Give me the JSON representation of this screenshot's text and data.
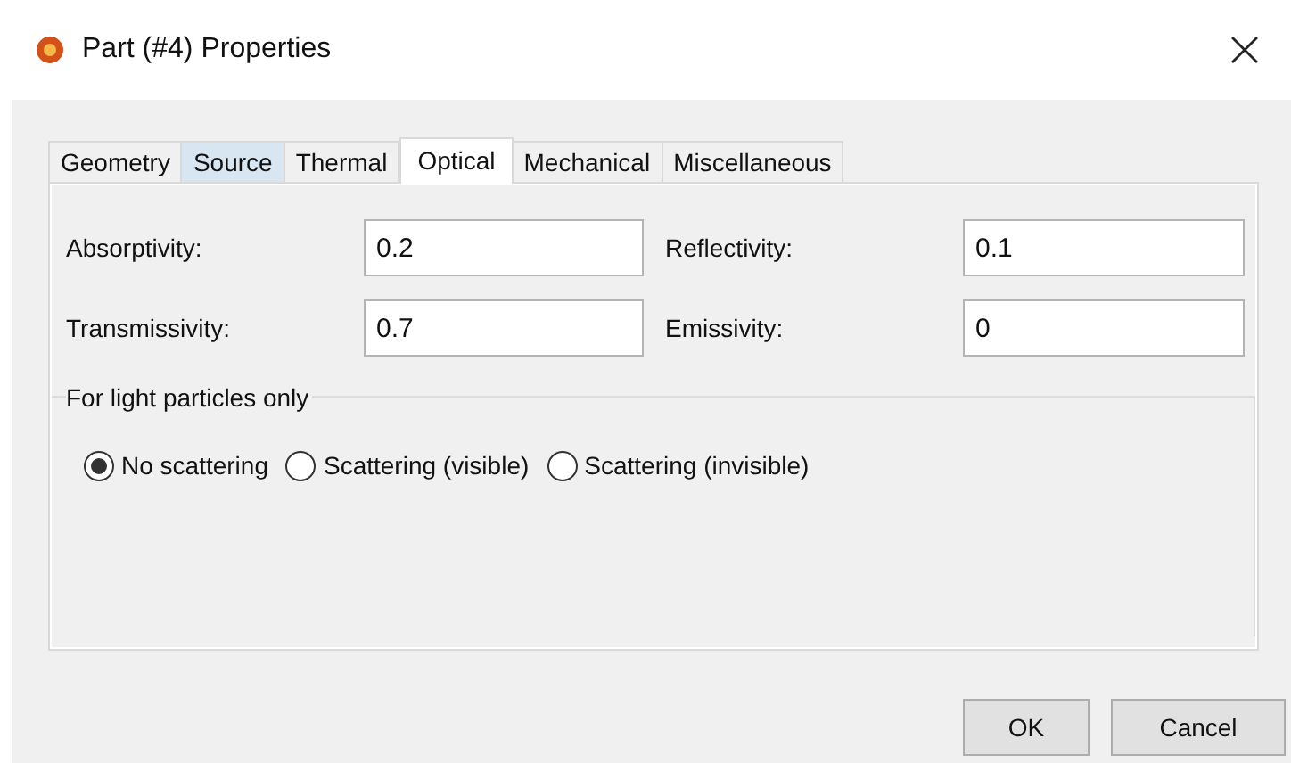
{
  "window": {
    "title": "Part (#4) Properties"
  },
  "tabs": [
    {
      "label": "Geometry",
      "selected": false,
      "hovered": false
    },
    {
      "label": "Source",
      "selected": false,
      "hovered": true
    },
    {
      "label": "Thermal",
      "selected": false,
      "hovered": false
    },
    {
      "label": "Optical",
      "selected": true,
      "hovered": false
    },
    {
      "label": "Mechanical",
      "selected": false,
      "hovered": false
    },
    {
      "label": "Miscellaneous",
      "selected": false,
      "hovered": false
    }
  ],
  "fields": [
    {
      "label": "Absorptivity:",
      "value": "0.2"
    },
    {
      "label": "Reflectivity:",
      "value": "0.1"
    },
    {
      "label": "Transmissivity:",
      "value": "0.7"
    },
    {
      "label": "Emissivity:",
      "value": "0"
    }
  ],
  "group": {
    "title": "For light particles only",
    "options": [
      {
        "label": "No scattering",
        "selected": true
      },
      {
        "label": "Scattering (visible)",
        "selected": false
      },
      {
        "label": "Scattering (invisible)",
        "selected": false
      }
    ]
  },
  "buttons": [
    "OK",
    "Cancel"
  ]
}
